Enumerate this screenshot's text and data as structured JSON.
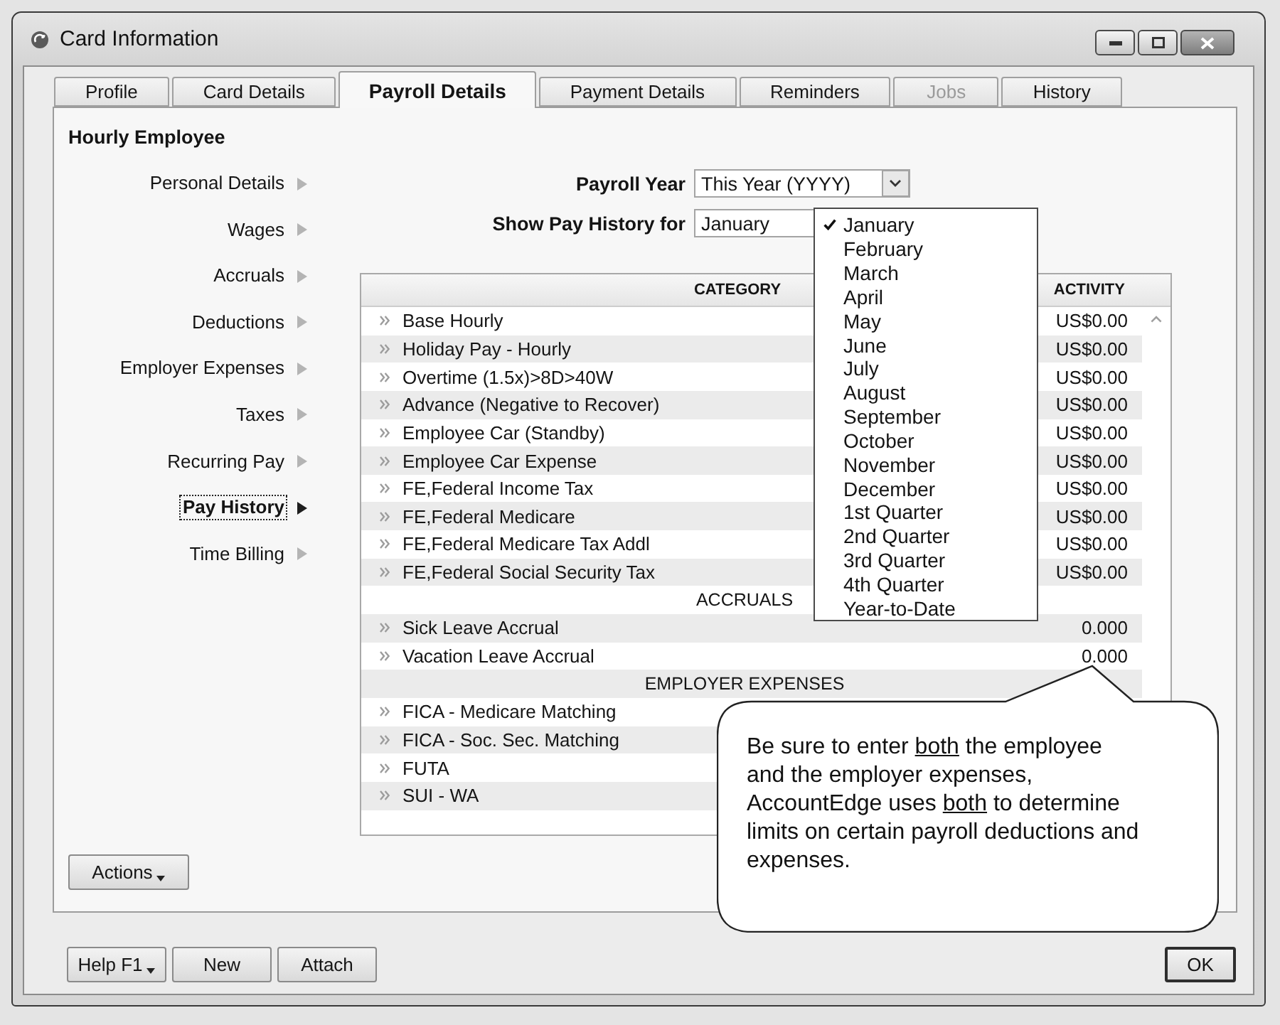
{
  "window": {
    "title": "Card Information"
  },
  "tabs": [
    {
      "label": "Profile",
      "selected": false,
      "disabled": false
    },
    {
      "label": "Card Details",
      "selected": false,
      "disabled": false
    },
    {
      "label": "Payroll Details",
      "selected": true,
      "disabled": false
    },
    {
      "label": "Payment Details",
      "selected": false,
      "disabled": false
    },
    {
      "label": "Reminders",
      "selected": false,
      "disabled": false
    },
    {
      "label": "Jobs",
      "selected": false,
      "disabled": true
    },
    {
      "label": "History",
      "selected": false,
      "disabled": false
    }
  ],
  "panel": {
    "heading": "Hourly Employee"
  },
  "sidebar": {
    "items": [
      {
        "label": "Personal Details",
        "selected": false
      },
      {
        "label": "Wages",
        "selected": false
      },
      {
        "label": "Accruals",
        "selected": false
      },
      {
        "label": "Deductions",
        "selected": false
      },
      {
        "label": "Employer Expenses",
        "selected": false
      },
      {
        "label": "Taxes",
        "selected": false
      },
      {
        "label": "Recurring Pay",
        "selected": false
      },
      {
        "label": "Pay History",
        "selected": true
      },
      {
        "label": "Time Billing",
        "selected": false
      }
    ]
  },
  "filters": [
    {
      "label": "Payroll Year",
      "value": "This Year (YYYY)",
      "open": false
    },
    {
      "label": "Show Pay History for",
      "value": "January",
      "open": true
    }
  ],
  "period_menu": {
    "items": [
      {
        "label": "January",
        "checked": true
      },
      {
        "label": "February",
        "checked": false
      },
      {
        "label": "March",
        "checked": false
      },
      {
        "label": "April",
        "checked": false
      },
      {
        "label": "May",
        "checked": false
      },
      {
        "label": "June",
        "checked": false
      },
      {
        "label": "July",
        "checked": false
      },
      {
        "label": "August",
        "checked": false
      },
      {
        "label": "September",
        "checked": false
      },
      {
        "label": "October",
        "checked": false
      },
      {
        "label": "November",
        "checked": false
      },
      {
        "label": "December",
        "checked": false
      },
      {
        "label": "1st Quarter",
        "checked": false
      },
      {
        "label": "2nd Quarter",
        "checked": false
      },
      {
        "label": "3rd Quarter",
        "checked": false
      },
      {
        "label": "4th Quarter",
        "checked": false
      },
      {
        "label": "Year-to-Date",
        "checked": false
      }
    ]
  },
  "table": {
    "columns": [
      "CATEGORY",
      "ACTIVITY"
    ],
    "rows": [
      {
        "kind": "item",
        "category": "Base Hourly",
        "activity": "US$0.00"
      },
      {
        "kind": "item",
        "category": "Holiday Pay - Hourly",
        "activity": "US$0.00"
      },
      {
        "kind": "item",
        "category": "Overtime (1.5x)>8D>40W",
        "activity": "US$0.00"
      },
      {
        "kind": "item",
        "category": "Advance (Negative to Recover)",
        "activity": "US$0.00"
      },
      {
        "kind": "item",
        "category": "Employee Car (Standby)",
        "activity": "US$0.00"
      },
      {
        "kind": "item",
        "category": "Employee Car Expense",
        "activity": "US$0.00"
      },
      {
        "kind": "item",
        "category": "FE,Federal Income Tax",
        "activity": "US$0.00"
      },
      {
        "kind": "item",
        "category": "FE,Federal Medicare",
        "activity": "US$0.00"
      },
      {
        "kind": "item",
        "category": "FE,Federal Medicare Tax Addl",
        "activity": "US$0.00"
      },
      {
        "kind": "item",
        "category": "FE,Federal Social Security Tax",
        "activity": "US$0.00"
      },
      {
        "kind": "section",
        "category": "ACCRUALS"
      },
      {
        "kind": "item",
        "category": "Sick Leave Accrual",
        "activity": "0.000"
      },
      {
        "kind": "item",
        "category": "Vacation Leave Accrual",
        "activity": "0.000"
      },
      {
        "kind": "section",
        "category": "EMPLOYER EXPENSES"
      },
      {
        "kind": "item",
        "category": "FICA - Medicare Matching"
      },
      {
        "kind": "item",
        "category": "FICA - Soc. Sec. Matching"
      },
      {
        "kind": "item",
        "category": "FUTA"
      },
      {
        "kind": "item",
        "category": "SUI - WA"
      }
    ]
  },
  "actions_button": {
    "label": "Actions"
  },
  "footer_buttons": [
    {
      "label": "Help F1",
      "kind": "menu"
    },
    {
      "label": "New",
      "kind": "plain"
    },
    {
      "label": "Attach",
      "kind": "plain"
    },
    {
      "label": "OK",
      "kind": "default"
    }
  ],
  "callout": {
    "lines": [
      {
        "segments": [
          {
            "text": "Be sure to enter ",
            "underline": false
          },
          {
            "text": "both",
            "underline": true
          },
          {
            "text": " the employee",
            "underline": false
          }
        ]
      },
      {
        "segments": [
          {
            "text": "and the employer expenses,",
            "underline": false
          }
        ]
      },
      {
        "segments": [
          {
            "text": "AccountEdge uses ",
            "underline": false
          },
          {
            "text": "both",
            "underline": true
          },
          {
            "text": " to determine",
            "underline": false
          }
        ]
      },
      {
        "segments": [
          {
            "text": "limits on certain payroll deductions and",
            "underline": false
          }
        ]
      },
      {
        "segments": [
          {
            "text": "expenses.",
            "underline": false
          }
        ]
      }
    ]
  }
}
